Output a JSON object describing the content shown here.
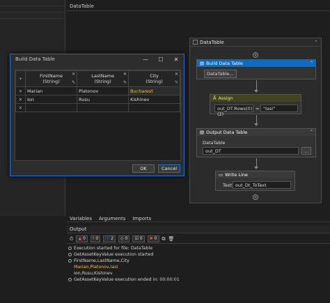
{
  "designer": {
    "breadcrumb": "DataTable"
  },
  "sequence": {
    "title": "DataTable",
    "activities": {
      "build": {
        "title": "Build Data Table",
        "button": "DataTable..."
      },
      "assign": {
        "title": "Assign",
        "left": "out_DT.Rows(0)(2)",
        "op": "=",
        "right": "\"Iasi\""
      },
      "output": {
        "title": "Output Data Table",
        "label": "DataTable",
        "value": "out_DT",
        "browse": "..."
      },
      "write": {
        "title": "Write Line",
        "label": "Text",
        "value": "out_Dt_ToText"
      }
    }
  },
  "dialog": {
    "title": "Build Data Table",
    "columns": [
      {
        "name": "FirstName",
        "type": "(String)"
      },
      {
        "name": "LastName",
        "type": "(String)"
      },
      {
        "name": "City",
        "type": "(String)"
      }
    ],
    "rows": [
      [
        "Marian",
        "Platonov",
        "Bucharest"
      ],
      [
        "Ion",
        "Rusu",
        "Kishinev"
      ]
    ],
    "ok": "OK",
    "cancel": "Cancel"
  },
  "bottom": {
    "tabs": [
      "Variables",
      "Arguments",
      "Imports"
    ],
    "output_title": "Output",
    "filters": [
      "0",
      "0",
      "2",
      "0",
      "0",
      "0"
    ],
    "log": [
      "Execution started for file: DataTable",
      "GetAssetKeyValue execution started",
      "FirstName,LastName,City",
      "Marian,Platonov,Iasi",
      "Ion,Rusu,Kishinev",
      "GetAssetKeyValue execution ended in: 00:00:01"
    ]
  },
  "colors": {
    "accent": "#0e6dc2",
    "highlight": "#e8c24a"
  }
}
